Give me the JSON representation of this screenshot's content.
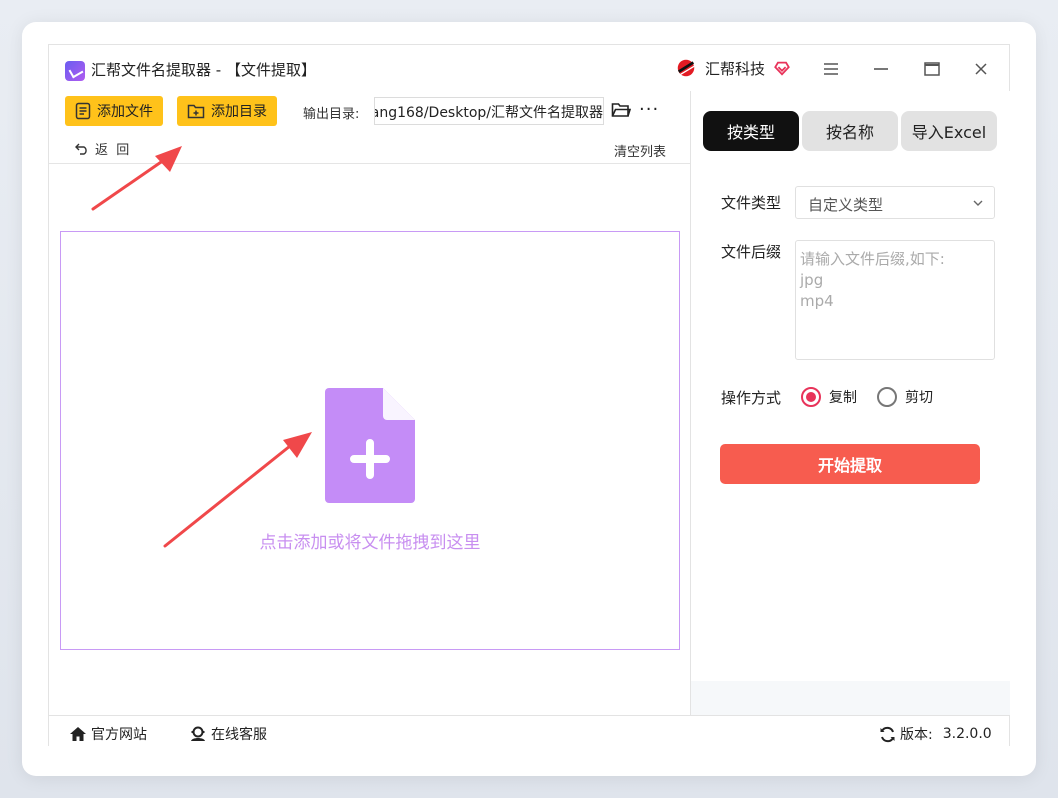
{
  "window": {
    "title": "汇帮文件名提取器 - 【文件提取】",
    "brand_name": "汇帮科技"
  },
  "toolbar": {
    "add_file_label": "添加文件",
    "add_dir_label": "添加目录",
    "output_label": "输出目录:",
    "output_value": "ang168/Desktop/汇帮文件名提取器",
    "more_label": "···",
    "back_label": "返  回",
    "clear_label": "清空列表"
  },
  "dropzone": {
    "hint": "点击添加或将文件拖拽到这里"
  },
  "tabs": [
    {
      "label": "按类型",
      "active": true
    },
    {
      "label": "按名称",
      "active": false
    },
    {
      "label": "导入Excel",
      "active": false
    }
  ],
  "settings": {
    "file_type_label": "文件类型",
    "file_type_value": "自定义类型",
    "suffix_label": "文件后缀",
    "suffix_placeholder": "请输入文件后缀,如下:\njpg\nmp4",
    "operation_label": "操作方式",
    "options": [
      {
        "label": "复制",
        "selected": true
      },
      {
        "label": "剪切",
        "selected": false
      }
    ],
    "start_label": "开始提取"
  },
  "status": {
    "website_label": "官方网站",
    "support_label": "在线客服",
    "version_label": "版本:",
    "version_value": "3.2.0.0"
  },
  "colors": {
    "accent_yellow": "#ffc21a",
    "start_red": "#f75c4f",
    "drop_purple": "#c48cf7",
    "radio_red": "#e8335a"
  }
}
